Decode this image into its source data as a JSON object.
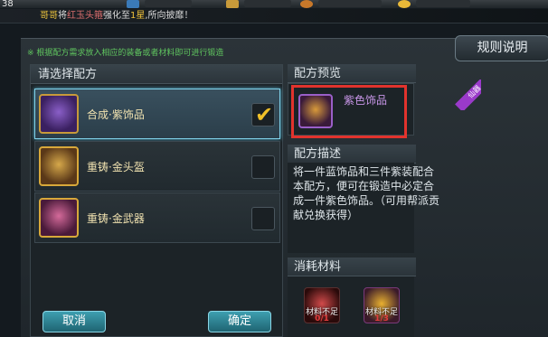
{
  "top_bar": {
    "level": "38"
  },
  "marquee": {
    "player": "哥哥",
    "text_part1": "将",
    "item": "红玉头箍",
    "text_part2": "强化至",
    "stars": "1星",
    "text_part3": ",所向披靡！"
  },
  "hint": "※ 根据配方需求放入相应的装备或者材料即可进行锻造",
  "rules_button": "规则说明",
  "recipe_list": {
    "title": "请选择配方",
    "items": [
      {
        "label": "合成·紫饰品",
        "selected": true
      },
      {
        "label": "重铸·金头盔",
        "selected": false
      },
      {
        "label": "重铸·金武器",
        "selected": false
      }
    ]
  },
  "buttons": {
    "cancel": "取消",
    "confirm": "确定"
  },
  "preview": {
    "title": "配方预览",
    "item_name": "紫色饰品",
    "ribbon": "仙器"
  },
  "description": {
    "title": "配方描述",
    "text": "将一件蓝饰品和三件紫装配合本配方，便可在锻造中必定合成一件紫色饰品。（可用帮派贡献兑换获得）"
  },
  "materials": {
    "title": "消耗材料",
    "items": [
      {
        "caption": "材料不足",
        "count": "0/1"
      },
      {
        "caption": "材料不足",
        "count": "1/3"
      }
    ]
  },
  "colors": {
    "highlight_box": "#e2332d",
    "selected_border": "#7fd0e8",
    "button": "#2a8494"
  }
}
